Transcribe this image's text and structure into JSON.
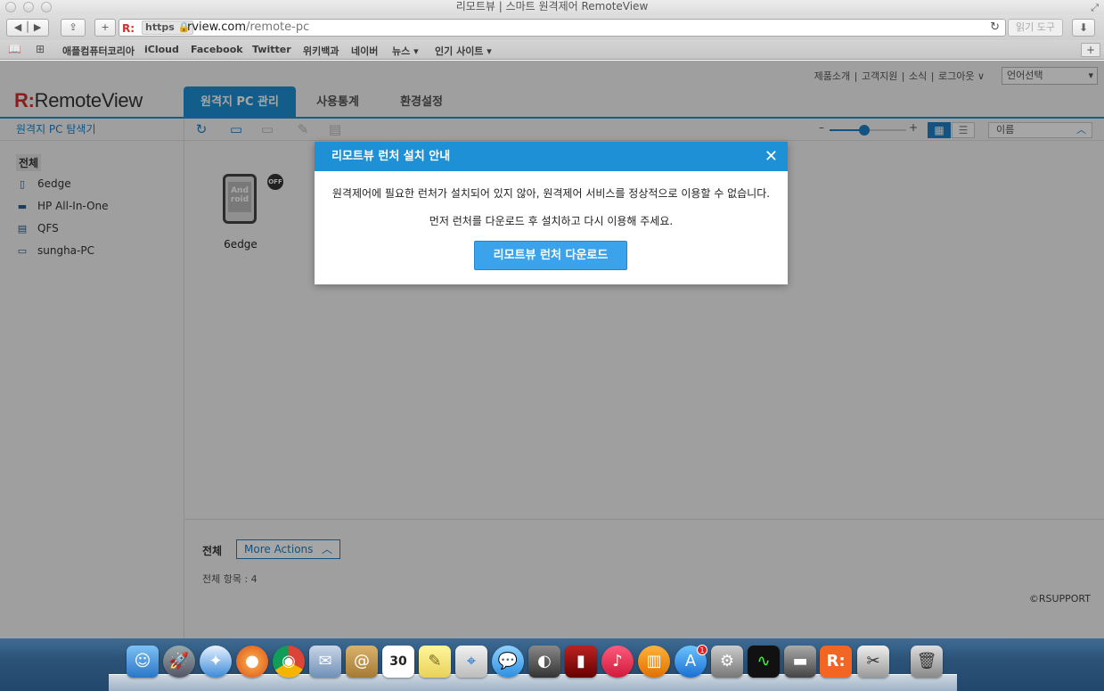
{
  "window": {
    "title": "리모트뷰 | 스마트 원격제어 RemoteView"
  },
  "browser": {
    "url_scheme": "https",
    "url_host": "rview.com",
    "url_path": "/remote-pc",
    "reader_label": "읽기 도구",
    "bookmarks": [
      "애플컴퓨터코리아",
      "iCloud",
      "Facebook",
      "Twitter",
      "위키백과",
      "네이버",
      "뉴스 ▾",
      "인기 사이트 ▾"
    ]
  },
  "site": {
    "logo_r": "R:",
    "logo_text": "RemoteView",
    "util_links": [
      "제품소개",
      "고객지원",
      "소식",
      "로그아웃 ∨"
    ],
    "language_select": "언어선택",
    "tabs": [
      "원격지 PC 관리",
      "사용통계",
      "환경설정"
    ],
    "active_tab": 0
  },
  "sidebar": {
    "title": "원격지 PC 탐색기",
    "all_label": "전체",
    "items": [
      {
        "label": "6edge",
        "icon": "phone-icon"
      },
      {
        "label": "HP All-In-One",
        "icon": "monitor-icon"
      },
      {
        "label": "QFS",
        "icon": "server-icon"
      },
      {
        "label": "sungha-PC",
        "icon": "desktop-icon"
      }
    ]
  },
  "content": {
    "sort_label": "이름",
    "zoom_level": 0.45,
    "device": {
      "name": "6edge",
      "status": "OFF",
      "screen_text": "And roid"
    }
  },
  "bottom": {
    "title": "전체",
    "more_actions": "More Actions",
    "count_text": "전체 항목 : 4",
    "copyright": "©RSUPPORT"
  },
  "modal": {
    "title": "리모트뷰 런처 설치 안내",
    "message1": "원격제어에 필요한 런처가 설치되어 있지 않아, 원격제어 서비스를 정상적으로 이용할 수 없습니다.",
    "message2": "먼저 런처를 다운로드 후 설치하고 다시 이용해 주세요.",
    "button": "리모트뷰 런처 다운로드",
    "close": "✕"
  },
  "dock": {
    "calendar_day": "30",
    "appstore_badge": "1"
  },
  "colors": {
    "accent": "#1e90d6",
    "brand_red": "#d32f2f"
  }
}
